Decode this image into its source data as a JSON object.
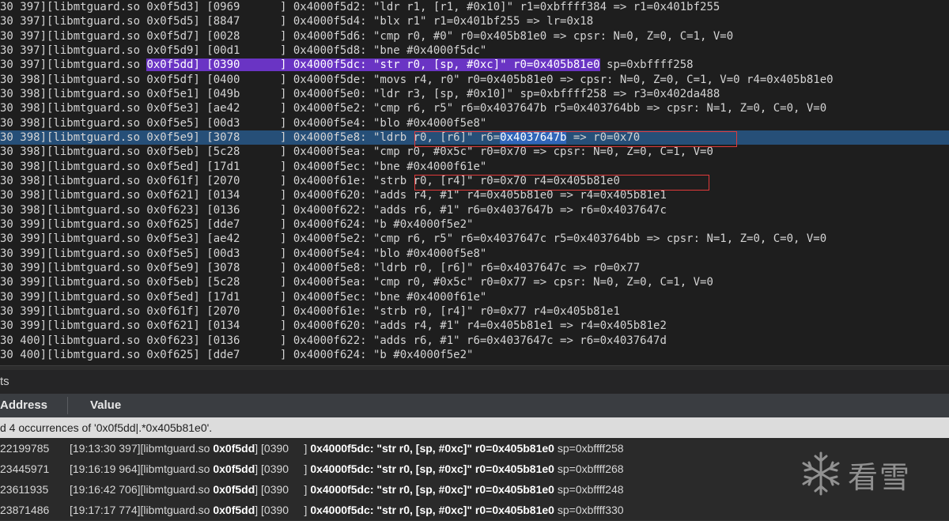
{
  "trace_lines": [
    {
      "segs": [
        {
          "t": "30 397][libmtguard.so 0x0f5d3] [0969      ] 0x4000f5d2: \"ldr r1, [r1, #0x10]\" r1=0xbffff384 => r1=0x401bf255"
        }
      ]
    },
    {
      "segs": [
        {
          "t": "30 397][libmtguard.so 0x0f5d5] [8847      ] 0x4000f5d4: \"blx r1\" r1=0x401bf255 => lr=0x18"
        }
      ]
    },
    {
      "segs": [
        {
          "t": "30 397][libmtguard.so 0x0f5d7] [0028      ] 0x4000f5d6: \"cmp r0, #0\" r0=0x405b81e0 => cpsr: N=0, Z=0, C=1, V=0"
        }
      ]
    },
    {
      "segs": [
        {
          "t": "30 397][libmtguard.so 0x0f5d9] [00d1      ] 0x4000f5d8: \"bne #0x4000f5dc\""
        }
      ]
    },
    {
      "segs": [
        {
          "t": "30 397][libmtguard.so "
        },
        {
          "t": "0x0f5dd] [0390      ] 0x4000f5dc: \"str r0, [sp, #0xc]\" r0=0x405b81e0",
          "c": "purple"
        },
        {
          "t": " sp=0xbffff258"
        }
      ]
    },
    {
      "segs": [
        {
          "t": "30 398][libmtguard.so 0x0f5df] [0400      ] 0x4000f5de: \"movs r4, r0\" r0=0x405b81e0 => cpsr: N=0, Z=0, C=1, V=0 r4=0x405b81e0"
        }
      ]
    },
    {
      "segs": [
        {
          "t": "30 398][libmtguard.so 0x0f5e1] [049b      ] 0x4000f5e0: \"ldr r3, [sp, #0x10]\" sp=0xbffff258 => r3=0x402da488"
        }
      ]
    },
    {
      "segs": [
        {
          "t": "30 398][libmtguard.so 0x0f5e3] [ae42      ] 0x4000f5e2: \"cmp r6, r5\" r6=0x4037647b r5=0x403764bb => cpsr: N=1, Z=0, C=0, V=0"
        }
      ]
    },
    {
      "segs": [
        {
          "t": "30 398][libmtguard.so 0x0f5e5] [00d3      ] 0x4000f5e4: \"blo #0x4000f5e8\""
        }
      ]
    },
    {
      "row": "hl",
      "segs": [
        {
          "t": "30 398][libmtguard.so 0x0f5e9] [3078      ] 0x4000f5e8: \"ldrb r0, [r6]\" r6="
        },
        {
          "t": "0x4037647b",
          "c": "sel"
        },
        {
          "t": " => r0=0x70"
        }
      ]
    },
    {
      "segs": [
        {
          "t": "30 398][libmtguard.so 0x0f5eb] [5c28      ] 0x4000f5ea: \"cmp r0, #0x5c\" r0=0x70 => cpsr: N=0, Z=0, C=1, V=0"
        }
      ]
    },
    {
      "segs": [
        {
          "t": "30 398][libmtguard.so 0x0f5ed] [17d1      ] 0x4000f5ec: \"bne #0x4000f61e\""
        }
      ]
    },
    {
      "segs": [
        {
          "t": "30 398][libmtguard.so 0x0f61f] [2070      ] 0x4000f61e: \"strb r0, [r4]\" r0=0x70 r4=0x405b81e0"
        }
      ]
    },
    {
      "segs": [
        {
          "t": "30 398][libmtguard.so 0x0f621] [0134      ] 0x4000f620: \"adds r4, #1\" r4=0x405b81e0 => r4=0x405b81e1"
        }
      ]
    },
    {
      "segs": [
        {
          "t": "30 398][libmtguard.so 0x0f623] [0136      ] 0x4000f622: \"adds r6, #1\" r6=0x4037647b => r6=0x4037647c"
        }
      ]
    },
    {
      "segs": [
        {
          "t": "30 399][libmtguard.so 0x0f625] [dde7      ] 0x4000f624: \"b #0x4000f5e2\""
        }
      ]
    },
    {
      "segs": [
        {
          "t": "30 399][libmtguard.so 0x0f5e3] [ae42      ] 0x4000f5e2: \"cmp r6, r5\" r6=0x4037647c r5=0x403764bb => cpsr: N=1, Z=0, C=0, V=0"
        }
      ]
    },
    {
      "segs": [
        {
          "t": "30 399][libmtguard.so 0x0f5e5] [00d3      ] 0x4000f5e4: \"blo #0x4000f5e8\""
        }
      ]
    },
    {
      "segs": [
        {
          "t": "30 399][libmtguard.so 0x0f5e9] [3078      ] 0x4000f5e8: \"ldrb r0, [r6]\" r6=0x4037647c => r0=0x77"
        }
      ]
    },
    {
      "segs": [
        {
          "t": "30 399][libmtguard.so 0x0f5eb] [5c28      ] 0x4000f5ea: \"cmp r0, #0x5c\" r0=0x77 => cpsr: N=0, Z=0, C=1, V=0"
        }
      ]
    },
    {
      "segs": [
        {
          "t": "30 399][libmtguard.so 0x0f5ed] [17d1      ] 0x4000f5ec: \"bne #0x4000f61e\""
        }
      ]
    },
    {
      "segs": [
        {
          "t": "30 399][libmtguard.so 0x0f61f] [2070      ] 0x4000f61e: \"strb r0, [r4]\" r0=0x77 r4=0x405b81e1"
        }
      ]
    },
    {
      "segs": [
        {
          "t": "30 399][libmtguard.so 0x0f621] [0134      ] 0x4000f620: \"adds r4, #1\" r4=0x405b81e1 => r4=0x405b81e2"
        }
      ]
    },
    {
      "segs": [
        {
          "t": "30 400][libmtguard.so 0x0f623] [0136      ] 0x4000f622: \"adds r6, #1\" r6=0x4037647c => r6=0x4037647d"
        }
      ]
    },
    {
      "segs": [
        {
          "t": "30 400][libmtguard.so 0x0f625] [dde7      ] 0x4000f624: \"b #0x4000f5e2\""
        }
      ]
    }
  ],
  "results_panel": {
    "title": "ts",
    "columns": {
      "address": "Address",
      "value": "Value"
    },
    "summary": "d 4 occurrences of '0x0f5dd|.*0x405b81e0'.",
    "rows": [
      {
        "address": "22199785",
        "time": "[19:13:30 397][libmtguard.so ",
        "off": "0x0f5dd",
        "code": "] [0390     ] ",
        "ins": "0x4000f5dc: \"str r0, [sp, #0xc]\" r0=0x405b81e0",
        "tail": " sp=0xbffff258"
      },
      {
        "address": "23445971",
        "time": "[19:16:19 964][libmtguard.so ",
        "off": "0x0f5dd",
        "code": "] [0390     ] ",
        "ins": "0x4000f5dc: \"str r0, [sp, #0xc]\" r0=0x405b81e0",
        "tail": " sp=0xbffff268"
      },
      {
        "address": "23611935",
        "time": "[19:16:42 706][libmtguard.so ",
        "off": "0x0f5dd",
        "code": "] [0390     ] ",
        "ins": "0x4000f5dc: \"str r0, [sp, #0xc]\" r0=0x405b81e0",
        "tail": " sp=0xbffff248"
      },
      {
        "address": "23871486",
        "time": "[19:17:17 774][libmtguard.so ",
        "off": "0x0f5dd",
        "code": "] [0390     ] ",
        "ins": "0x4000f5dc: \"str r0, [sp, #0xc]\" r0=0x405b81e0",
        "tail": " sp=0xbffff330"
      }
    ]
  },
  "watermark": {
    "text": "看雪",
    "icon": "snowflake-icon"
  },
  "colors": {
    "trace_bg": "#1e1e1e",
    "purple_highlight": "#6a34c4",
    "selection": "#2f65b8",
    "row_highlight": "#264f78",
    "annotation_box": "#e03a3a"
  }
}
